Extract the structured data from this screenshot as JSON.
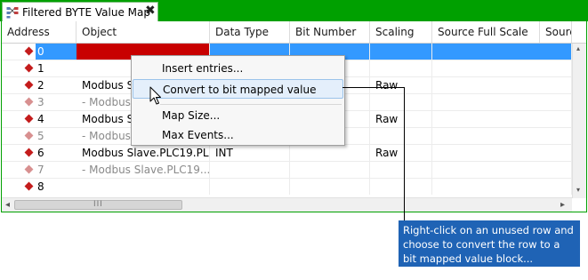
{
  "tab": {
    "title": "Filtered BYTE Value Map",
    "close_glyph": "✖",
    "icon": "value-map-icon"
  },
  "columns": [
    "Address",
    "Object",
    "Data Type",
    "Bit Number",
    "Scaling",
    "Source Full Scale",
    "Source"
  ],
  "rows": [
    {
      "address": "0",
      "object": "",
      "data_type": "",
      "bit_number": "",
      "scaling": "",
      "source_full_scale": "",
      "state": "selected"
    },
    {
      "address": "1",
      "object": "",
      "data_type": "",
      "bit_number": "",
      "scaling": "",
      "source_full_scale": "",
      "state": "normal"
    },
    {
      "address": "2",
      "object": "Modbus Sl",
      "data_type": "",
      "bit_number": "",
      "scaling": "Raw",
      "source_full_scale": "",
      "state": "normal"
    },
    {
      "address": "3",
      "object": "- Modbus",
      "data_type": "",
      "bit_number": "",
      "scaling": "",
      "source_full_scale": "",
      "state": "dim"
    },
    {
      "address": "4",
      "object": "Modbus Sl",
      "data_type": "",
      "bit_number": "",
      "scaling": "Raw",
      "source_full_scale": "",
      "state": "normal"
    },
    {
      "address": "5",
      "object": "- Modbus",
      "data_type": "",
      "bit_number": "",
      "scaling": "",
      "source_full_scale": "",
      "state": "dim"
    },
    {
      "address": "6",
      "object": "Modbus Slave.PLC19.PL...",
      "data_type": "INT",
      "bit_number": "",
      "scaling": "Raw",
      "source_full_scale": "",
      "state": "normal"
    },
    {
      "address": "7",
      "object": "- Modbus Slave.PLC19...",
      "data_type": "",
      "bit_number": "",
      "scaling": "",
      "source_full_scale": "",
      "state": "dim"
    },
    {
      "address": "8",
      "object": "",
      "data_type": "",
      "bit_number": "",
      "scaling": "",
      "source_full_scale": "",
      "state": "normal"
    }
  ],
  "context_menu": {
    "items": [
      "Insert entries...",
      "Convert to bit mapped value",
      "Map Size...",
      "Max Events..."
    ],
    "highlighted": "Convert to bit mapped value"
  },
  "scrollbar": {
    "grip": "III",
    "left_arrow": "◂",
    "right_arrow": "▸",
    "up_arrow": "▴",
    "down_arrow": "▾"
  },
  "callout": {
    "text": "Right-click on an unused row and choose to convert the row to a bit mapped value block...",
    "color": "#1f63b5"
  },
  "colors": {
    "tab_strip": "#00a000",
    "selection": "#3399ff",
    "object_red": "#c80000",
    "menu_highlight": "#e4effb"
  }
}
